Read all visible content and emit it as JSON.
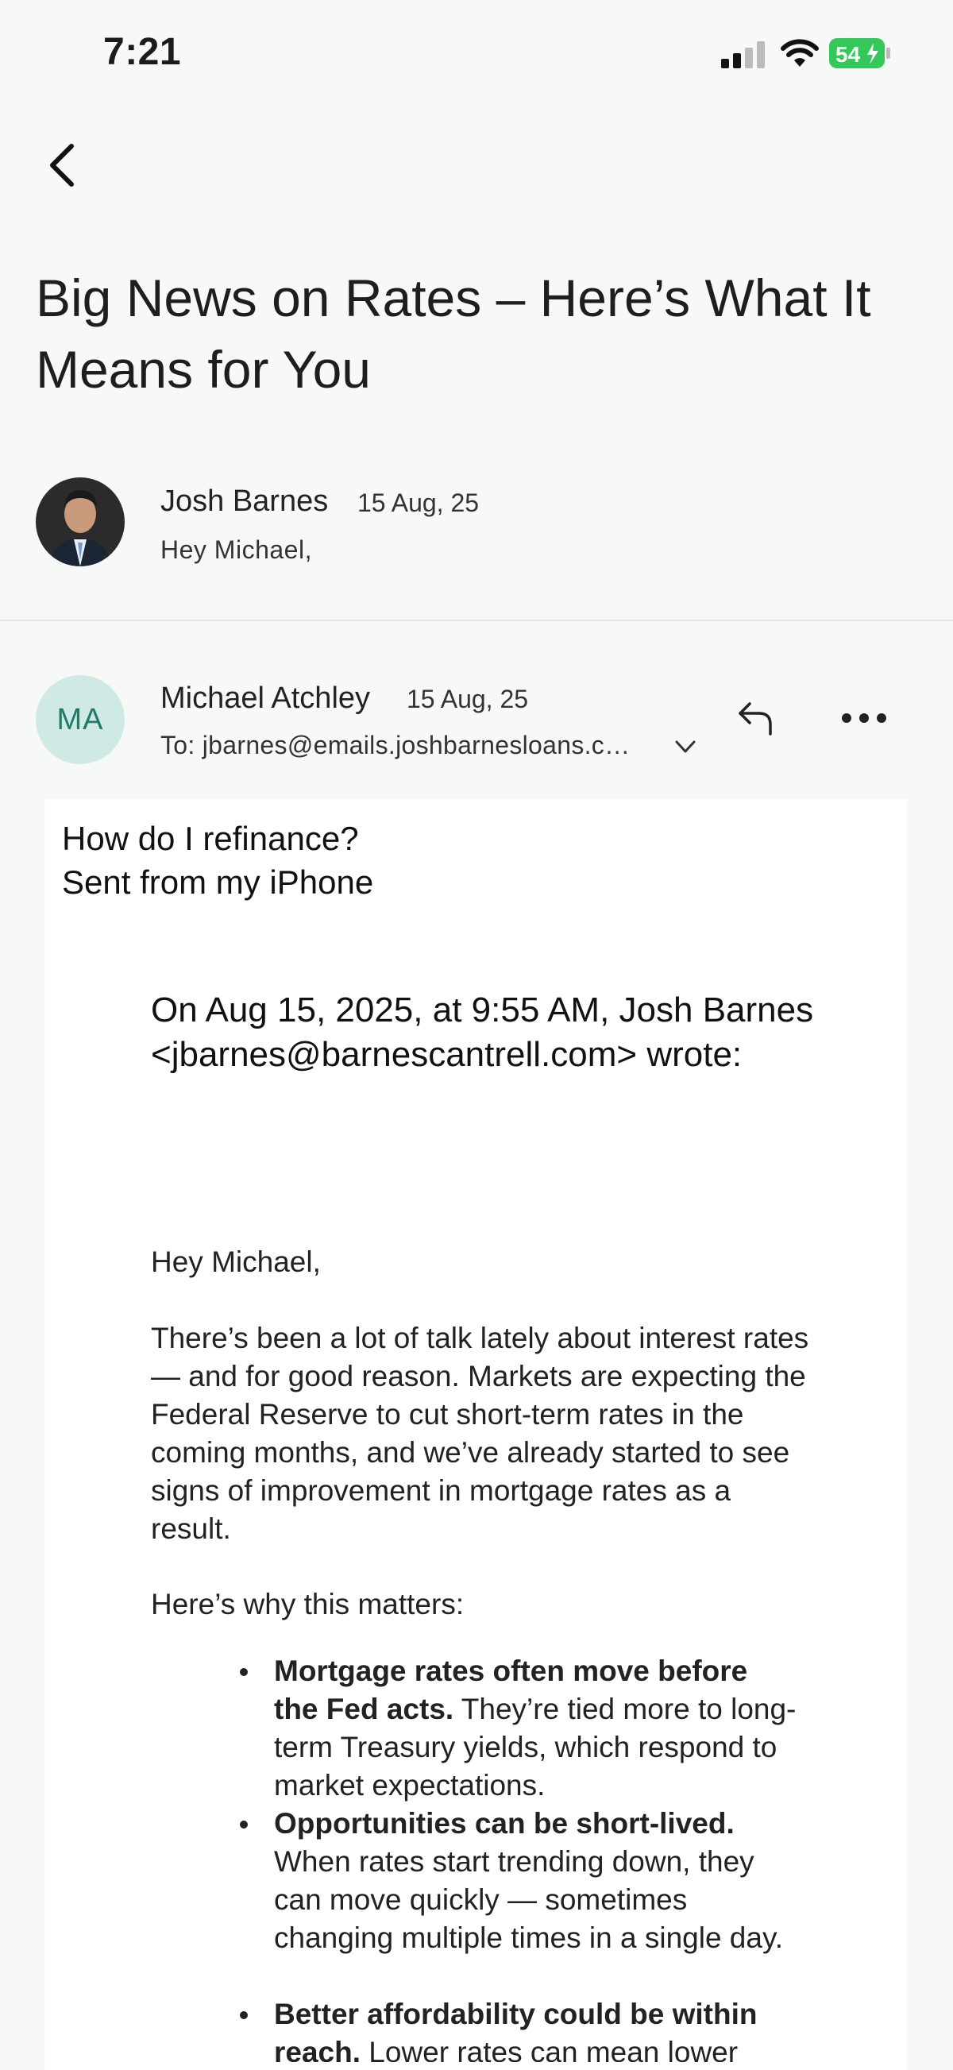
{
  "status_bar": {
    "time": "7:21",
    "battery": "54"
  },
  "email": {
    "subject": "Big News on Rates – Here’s What It Means for You",
    "first_message": {
      "sender": "Josh Barnes",
      "date": "15 Aug, 25",
      "snippet": "Hey Michael,"
    },
    "second_message": {
      "avatar_initials": "MA",
      "sender": "Michael Atchley",
      "date": "15 Aug, 25",
      "to_line": "To: jbarnes@emails.joshbarnesloans.c…",
      "body_line1": "How do I refinance?",
      "body_line2": "Sent from my iPhone",
      "quote_header": "On Aug 15, 2025, at 9:55 AM, Josh Barnes <jbarnes@barnescantrell.com> wrote:",
      "greeting": "Hey Michael,",
      "paragraph1": "There’s been a lot of talk lately about interest rates — and for good reason. Markets are expecting the Federal Reserve to cut short-term rates in the coming months, and we’ve already started to see signs of improvement in mortgage rates as a result.",
      "paragraph2": "Here’s why this matters:",
      "bullets": [
        {
          "bold": "Mortgage rates often move before the Fed acts.",
          "text": " They’re tied more to long-term Treasury yields, which respond to market expectations."
        },
        {
          "bold": "Opportunities can be short-lived.",
          "text": " When rates start trending down, they can move quickly — sometimes changing multiple times in a single day."
        },
        {
          "bold": "Better affordability could be within reach.",
          "text": " Lower rates can mean lower"
        }
      ]
    }
  },
  "icons": {
    "back": "chevron-left-icon",
    "reply": "reply-icon",
    "more": "more-horizontal-icon",
    "expand": "chevron-down-icon"
  },
  "colors": {
    "background": "#f7f9f6",
    "avatar_bg": "#cfeae4",
    "avatar_text": "#1f7a68",
    "battery_green": "#34c759"
  }
}
